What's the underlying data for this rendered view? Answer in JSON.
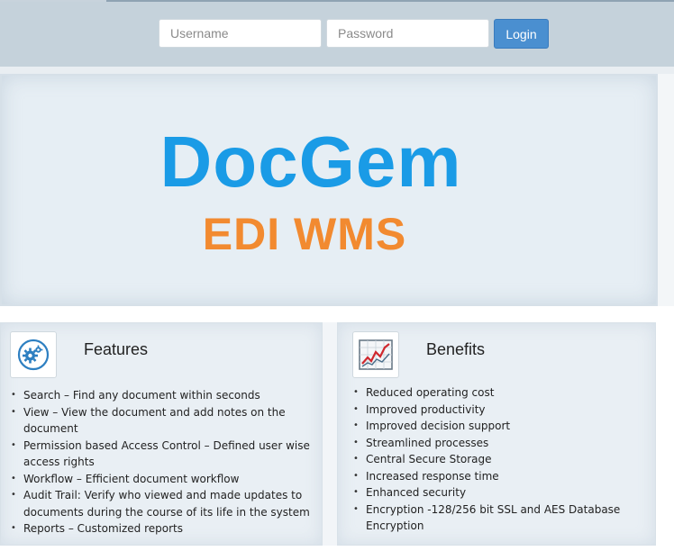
{
  "login": {
    "username_placeholder": "Username",
    "password_placeholder": "Password",
    "login_label": "Login"
  },
  "hero": {
    "brand": "DocGem",
    "subtitle": "EDI WMS"
  },
  "features": {
    "title": "Features",
    "icon": "gears-icon",
    "items": [
      "Search – Find any document within seconds",
      "View – View the document and add notes on the document",
      "Permission based Access Control – Defined user wise access rights",
      "Workflow – Efficient document workflow",
      "Audit Trail: Verify who viewed and made updates to documents during the course of its life in the system",
      "Reports – Customized reports"
    ]
  },
  "benefits": {
    "title": "Benefits",
    "icon": "line-chart-icon",
    "items": [
      "Reduced operating cost",
      "Improved productivity",
      "Improved decision support",
      "Streamlined processes",
      "Central Secure Storage",
      "Increased response time",
      "Enhanced security",
      "Encryption -128/256 bit SSL and AES Database Encryption"
    ]
  },
  "colors": {
    "brand_blue": "#1a9be6",
    "brand_orange": "#f28a30",
    "login_button": "#4a8fd0",
    "header_bg": "#c5d2db"
  }
}
